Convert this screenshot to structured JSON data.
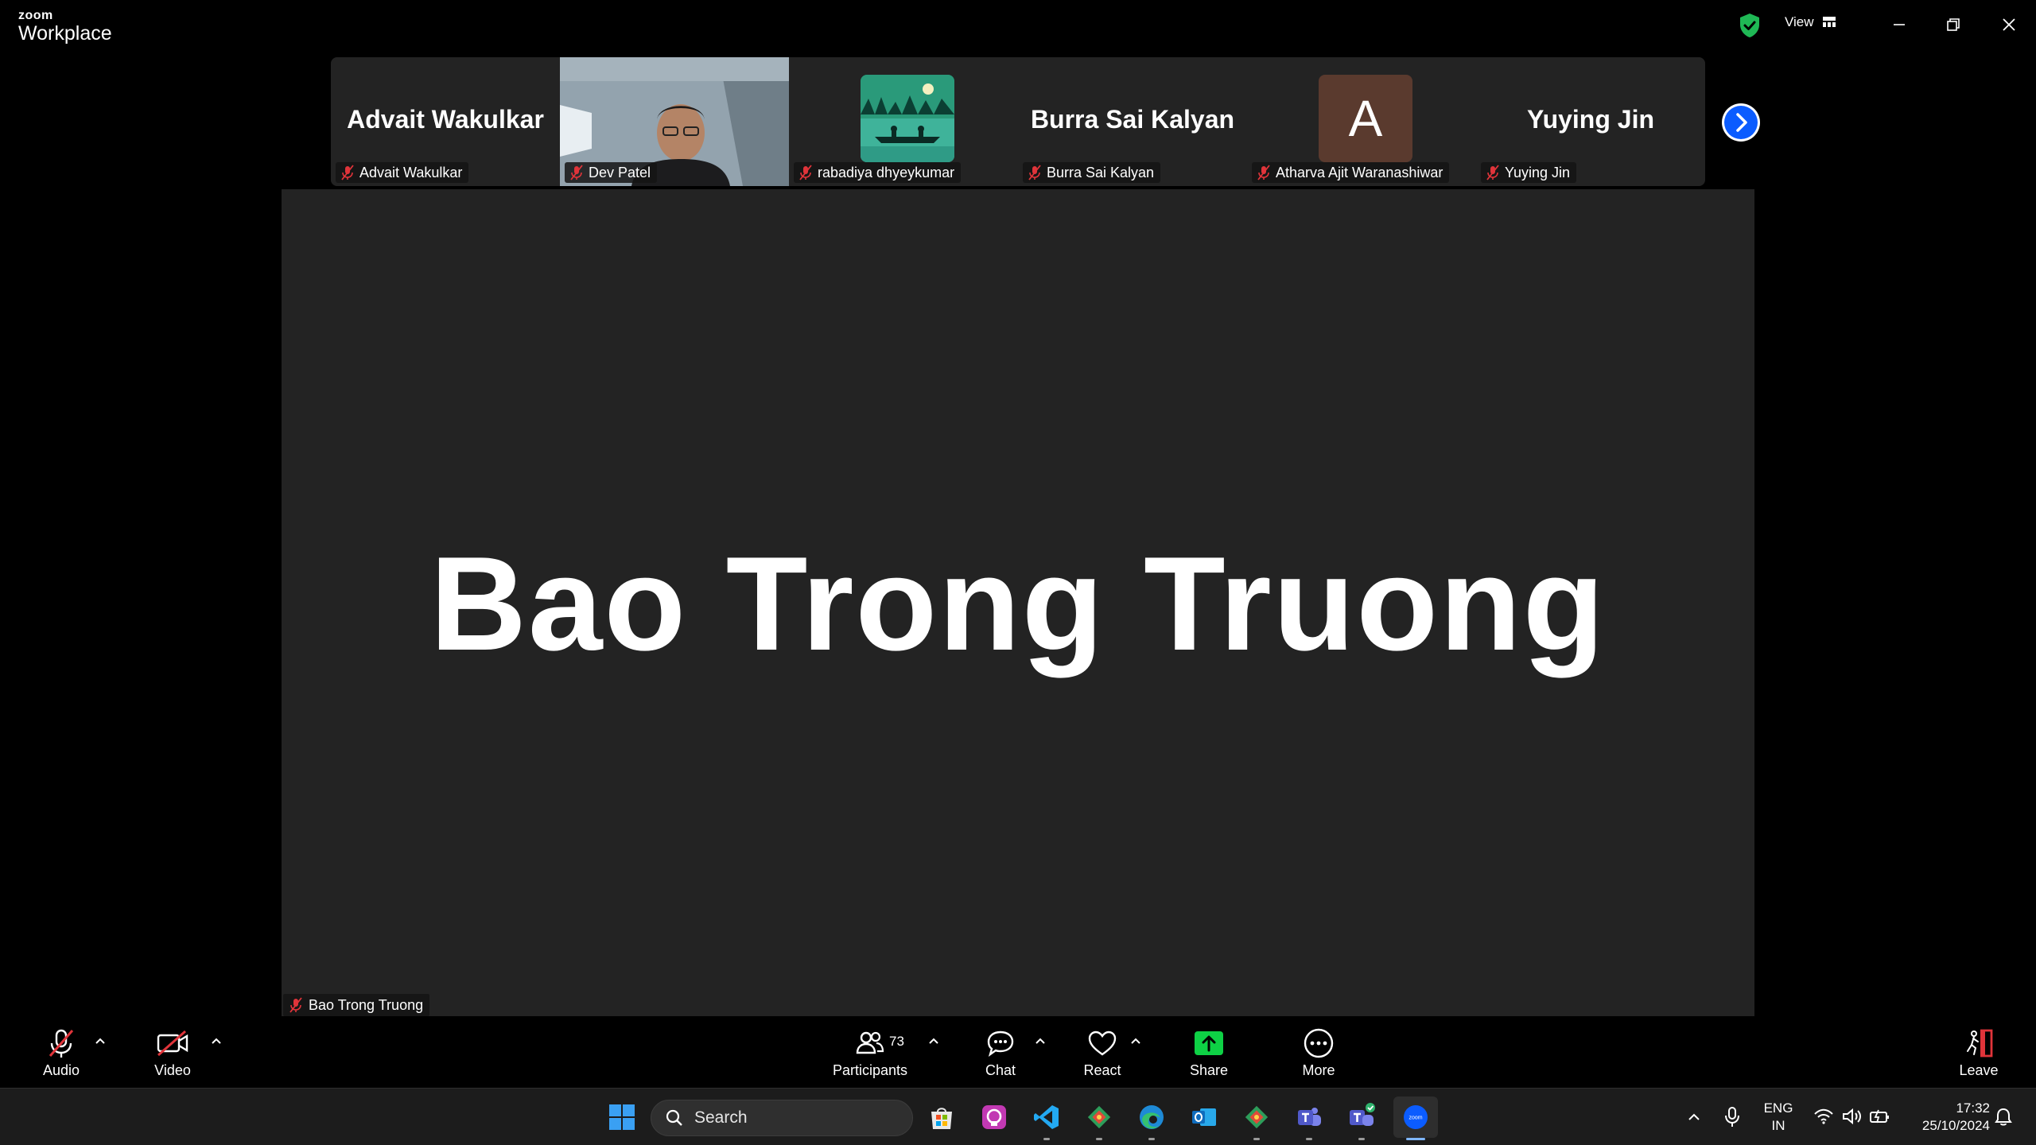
{
  "app": {
    "brand_small": "zoom",
    "brand_large": "Workplace",
    "view_label": "View"
  },
  "gallery": [
    {
      "big_name": "Advait Wakulkar",
      "label": "Advait Wakulkar",
      "kind": "name"
    },
    {
      "big_name": "",
      "label": "Dev Patel",
      "kind": "video"
    },
    {
      "big_name": "",
      "label": "rabadiya dhyeykumar",
      "kind": "image"
    },
    {
      "big_name": "Burra Sai Kalyan",
      "label": "Burra Sai Kalyan",
      "kind": "name"
    },
    {
      "big_name": "",
      "label": "Atharva Ajit Waranashiwar",
      "kind": "letter",
      "letter": "A"
    },
    {
      "big_name": "Yuying Jin",
      "label": "Yuying Jin",
      "kind": "name"
    }
  ],
  "main": {
    "big_name": "Bao Trong Truong",
    "label": "Bao Trong Truong"
  },
  "toolbar": {
    "audio": "Audio",
    "video": "Video",
    "participants": "Participants",
    "participants_count": "73",
    "chat": "Chat",
    "react": "React",
    "share": "Share",
    "more": "More",
    "leave": "Leave"
  },
  "taskbar": {
    "search_placeholder": "Search",
    "lang_top": "ENG",
    "lang_bottom": "IN",
    "time": "17:32",
    "date": "25/10/2024"
  },
  "colors": {
    "share_green": "#0ed145",
    "muted_red": "#e0343a",
    "accent_blue": "#0b5cff",
    "tile_bg": "#232323"
  }
}
